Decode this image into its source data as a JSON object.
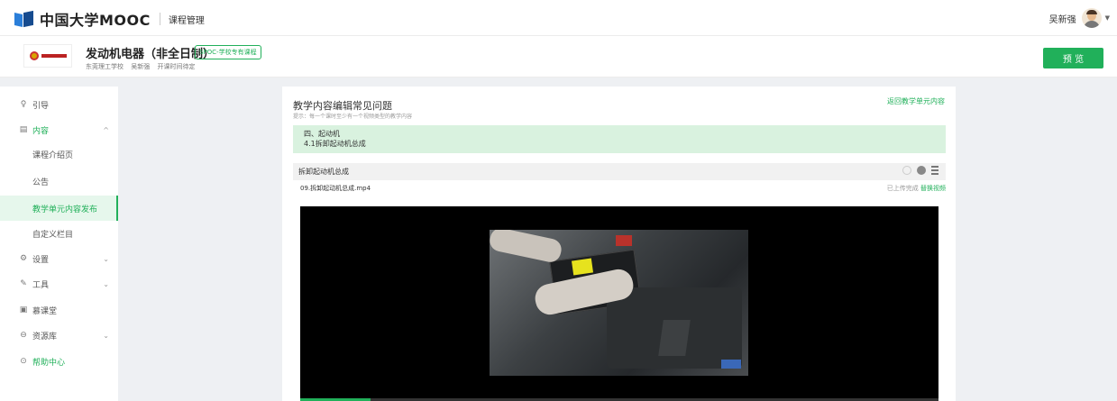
{
  "topbar": {
    "logo_text": "中国大学MOOC",
    "subtitle": "课程管理",
    "user_name": "吴新强"
  },
  "course": {
    "title": "发动机电器（非全日制）",
    "badge": "SPOC-学校专有课程",
    "school": "东莞理工学校",
    "teacher": "吴新强",
    "schedule": "开课时间待定",
    "preview_label": "预 览"
  },
  "sidebar": {
    "items": [
      {
        "icon": "guide-icon",
        "label": "引导"
      },
      {
        "icon": "content-icon",
        "label": "内容"
      },
      {
        "icon": "settings-icon",
        "label": "设置"
      },
      {
        "icon": "tools-icon",
        "label": "工具"
      },
      {
        "icon": "classroom-icon",
        "label": "慕课堂"
      },
      {
        "icon": "resource-icon",
        "label": "资源库"
      },
      {
        "icon": "help-icon",
        "label": "帮助中心"
      }
    ],
    "sub_items": [
      "课程介绍页",
      "公告",
      "教学单元内容发布",
      "自定义栏目"
    ]
  },
  "panel": {
    "title": "教学内容编辑常见问题",
    "hint": "提示：每一个课时至少有一个视频类型的教学内容",
    "back_link": "返回教学单元内容",
    "unit_chapter": "四、起动机",
    "unit_lesson": "4.1拆卸起动机总成",
    "lesson_title": "拆卸起动机总成",
    "file_name": "09.拆卸起动机总成.mp4",
    "upload_status": "已上传完成",
    "replace_link": "替换视频"
  },
  "video": {
    "progress_percent": 11
  },
  "colors": {
    "accent": "#21b05a",
    "page_bg": "#eef0f3"
  }
}
